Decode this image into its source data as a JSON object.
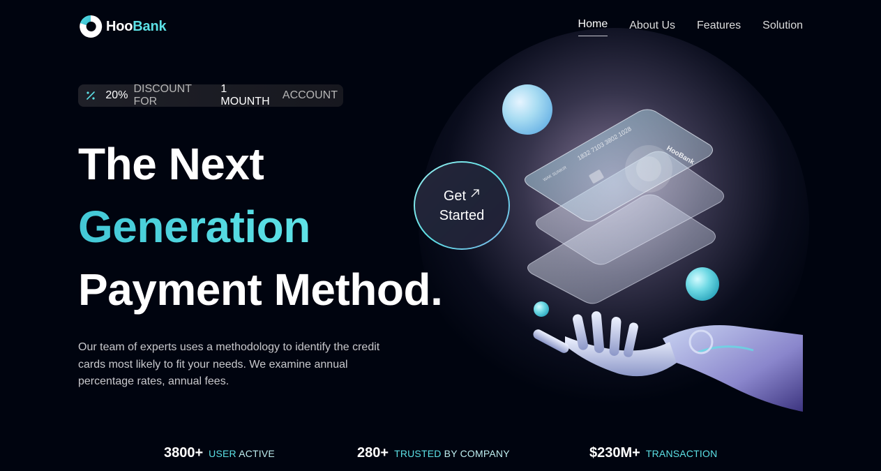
{
  "brand": {
    "name_part1": "Hoo",
    "name_part2": "Bank",
    "accent_color": "#5ce1e6",
    "background_color": "#00040f"
  },
  "nav": {
    "items": [
      {
        "label": "Home",
        "active": true
      },
      {
        "label": "About Us",
        "active": false
      },
      {
        "label": "Features",
        "active": false
      },
      {
        "label": "Solution",
        "active": false
      }
    ]
  },
  "discount": {
    "icon": "percent-icon",
    "percent": "20%",
    "text1": "DISCOUNT FOR",
    "duration": "1 MOUNTH",
    "text2": "ACCOUNT"
  },
  "hero": {
    "line1": "The Next",
    "line2": "Generation",
    "line3": "Payment Method.",
    "description": "Our team of experts uses a methodology to identify the credit cards most likely to fit your needs. We examine annual percentage rates, annual fees.",
    "cta_line1": "Get",
    "cta_line2": "Started",
    "cta_icon": "arrow-up-right-icon",
    "card_number": "1832 7103 3802 1028",
    "card_brand": "HooBank",
    "card_holder": "WAK SUNKIR"
  },
  "stats": [
    {
      "value": "3800+",
      "label_a": "USER",
      "label_b": "ACTIVE"
    },
    {
      "value": "280+",
      "label_a": "TRUSTED",
      "label_b": "BY COMPANY"
    },
    {
      "value": "$230M+",
      "label_a": "TRANSACTION",
      "label_b": ""
    }
  ]
}
